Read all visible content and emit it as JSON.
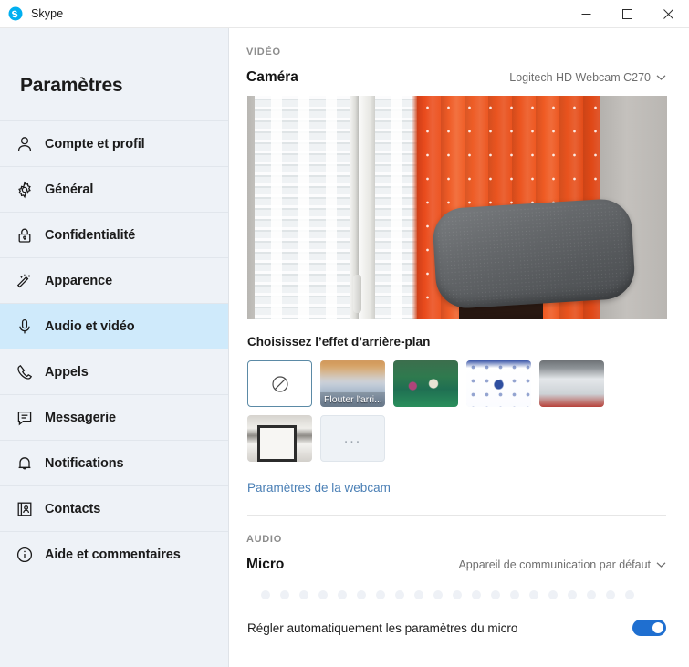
{
  "window": {
    "app_title": "Skype",
    "logo_icon": "skype-logo-icon",
    "minimize_icon": "minimize-icon",
    "maximize_icon": "maximize-icon",
    "close_icon": "close-icon"
  },
  "sidebar": {
    "title": "Paramètres",
    "items": [
      {
        "label": "Compte et profil",
        "icon": "person-icon",
        "selected": false
      },
      {
        "label": "Général",
        "icon": "gear-icon",
        "selected": false
      },
      {
        "label": "Confidentialité",
        "icon": "lock-icon",
        "selected": false
      },
      {
        "label": "Apparence",
        "icon": "magic-wand-icon",
        "selected": false
      },
      {
        "label": "Audio et vidéo",
        "icon": "microphone-icon",
        "selected": true
      },
      {
        "label": "Appels",
        "icon": "phone-icon",
        "selected": false
      },
      {
        "label": "Messagerie",
        "icon": "chat-bubble-icon",
        "selected": false
      },
      {
        "label": "Notifications",
        "icon": "bell-icon",
        "selected": false
      },
      {
        "label": "Contacts",
        "icon": "address-book-icon",
        "selected": false
      },
      {
        "label": "Aide et commentaires",
        "icon": "info-circle-icon",
        "selected": false
      }
    ]
  },
  "main": {
    "video_section": {
      "heading": "VIDÉO",
      "camera_label": "Caméra",
      "camera_value": "Logitech HD Webcam C270",
      "camera_caret_icon": "chevron-down-icon",
      "preview_alt": "camera-preview"
    },
    "background_effects": {
      "title": "Choisissez l’effet d’arrière-plan",
      "options": [
        {
          "name": "none",
          "caption": "",
          "icon": "no-effect-icon",
          "selected": true
        },
        {
          "name": "blur",
          "caption": "Flouter l'arri...",
          "icon": "",
          "selected": false
        },
        {
          "name": "image-1",
          "caption": "",
          "icon": "",
          "selected": false
        },
        {
          "name": "image-2",
          "caption": "",
          "icon": "",
          "selected": false
        },
        {
          "name": "image-3",
          "caption": "",
          "icon": "",
          "selected": false
        },
        {
          "name": "image-4",
          "caption": "",
          "icon": "",
          "selected": false
        },
        {
          "name": "more",
          "caption": "...",
          "icon": "ellipsis-icon",
          "selected": false
        }
      ],
      "webcam_settings_link": "Paramètres de la webcam"
    },
    "audio_section": {
      "heading": "AUDIO",
      "mic_label": "Micro",
      "mic_value": "Appareil de communication par défaut",
      "mic_caret_icon": "chevron-down-icon",
      "mic_level_dots": 20,
      "mic_level_active": 0,
      "auto_adjust_label": "Régler automatiquement les paramètres du micro",
      "auto_adjust_on": true
    }
  },
  "colors": {
    "accent": "#1f6fd0",
    "sidebar_bg": "#eef2f7",
    "selected_item_bg": "#cfeafb",
    "link": "#4a7fb5",
    "section_heading": "#8c8c8c"
  }
}
